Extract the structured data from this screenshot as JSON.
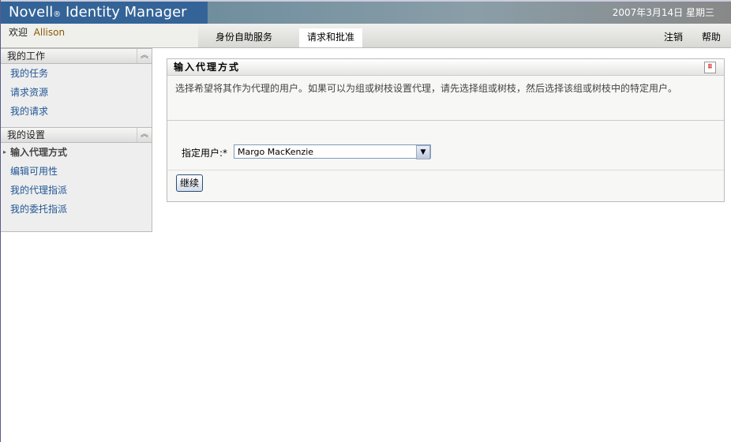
{
  "header": {
    "logo": "Novell",
    "logo_reg": "®",
    "logo_rest": " Identity Manager",
    "date": "2007年3月14日  星期三"
  },
  "nav": {
    "welcome": "欢迎",
    "user": "Allison",
    "tabs": [
      {
        "label": "身份自助服务"
      },
      {
        "label": "请求和批准"
      }
    ],
    "logout": "注销",
    "help": "帮助"
  },
  "sidebar": {
    "sections": [
      {
        "title": "我的工作",
        "items": [
          "我的任务",
          "请求资源",
          "我的请求"
        ]
      },
      {
        "title": "我的设置",
        "items": [
          "输入代理方式",
          "编辑可用性",
          "我的代理指派",
          "我的委托指派"
        ]
      }
    ]
  },
  "panel": {
    "title": "输入代理方式",
    "description": "选择希望将其作为代理的用户。如果可以为组或树枝设置代理，请先选择组或树枝，然后选择该组或树枝中的特定用户。",
    "field_label": "指定用户:*",
    "field_value": "Margo MacKenzie",
    "continue": "继续"
  }
}
